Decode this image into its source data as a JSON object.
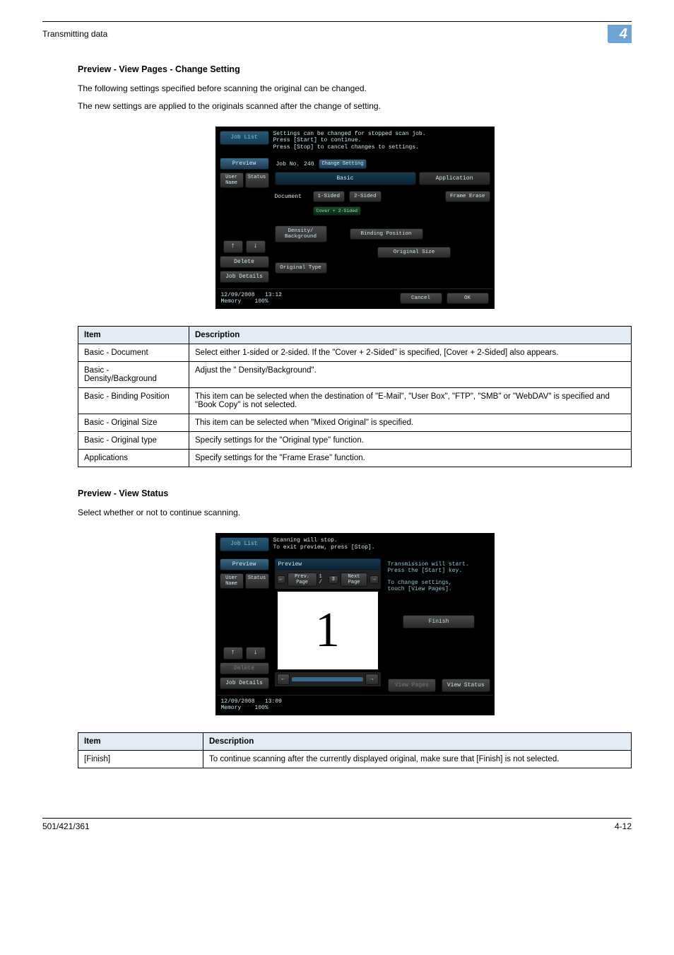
{
  "header": {
    "section": "Transmitting data",
    "chapter_number": "4"
  },
  "section1": {
    "heading": "Preview - View Pages - Change Setting",
    "p1": "The following settings specified before scanning the original can be changed.",
    "p2": "The new settings are applied to the originals scanned after the change of setting."
  },
  "screenshot1": {
    "job_list": "Job List",
    "msg_l1": "Settings can be changed for stopped scan job.",
    "msg_l2": "Press [Start] to continue.",
    "msg_l3": "Press [Stop] to cancel changes to settings.",
    "preview_btn": "Preview",
    "user_tab": "User Name",
    "status_tab": "Status",
    "up_arrow": "↑",
    "down_arrow": "↓",
    "delete_btn": "Delete",
    "job_details_btn": "Job Details",
    "job_no_label": "Job No.",
    "job_no_value": "240",
    "change_setting": "Change Setting",
    "tab_basic": "Basic",
    "tab_application": "Application",
    "lbl_document": "Document",
    "lbl_1sided": "1-Sided",
    "lbl_2sided": "2-Sided",
    "lbl_cover2sided": "Cover + 2-Sided",
    "lbl_frame_erase": "Frame Erase",
    "lbl_density": "Density/ Background",
    "lbl_binding": "Binding Position",
    "lbl_orig_size": "Original Size",
    "lbl_orig_type": "Original Type",
    "footer_date": "12/09/2008",
    "footer_time": "13:12",
    "footer_mem": "Memory",
    "footer_pct": "100%",
    "btn_cancel": "Cancel",
    "btn_ok": "OK"
  },
  "table1": {
    "h_item": "Item",
    "h_desc": "Description",
    "rows": [
      {
        "item": "Basic - Document",
        "desc": "Select either 1-sided or 2-sided. If the \"Cover + 2-Sided\" is specified, [Cover + 2-Sided] also appears."
      },
      {
        "item": "Basic - Density/Background",
        "desc": "Adjust the \" Density/Background\"."
      },
      {
        "item": "Basic - Binding Position",
        "desc": "This item can be selected when the destination of \"E-Mail\", \"User Box\", \"FTP\", \"SMB\" or \"WebDAV\" is specified and \"Book Copy\" is not selected."
      },
      {
        "item": "Basic - Original Size",
        "desc": "This item can be selected when \"Mixed Original\" is specified."
      },
      {
        "item": "Basic - Original type",
        "desc": "Specify settings for the \"Original type\" function."
      },
      {
        "item": "Applications",
        "desc": "Specify settings for the \"Frame Erase\" function."
      }
    ]
  },
  "section2": {
    "heading": "Preview - View Status",
    "p1": "Select whether or not to continue scanning."
  },
  "screenshot2": {
    "job_list": "Job List",
    "msg_l1": "Scanning will stop.",
    "msg_l2": "To exit preview, press [Stop].",
    "preview_btn": "Preview",
    "user_tab": "User Name",
    "status_tab": "Status",
    "up_arrow": "↑",
    "down_arrow": "↓",
    "delete_btn": "Delete",
    "job_details_btn": "Job Details",
    "preview_header": "Preview",
    "nav_left": "←",
    "prev_page": "Prev. Page",
    "page_count": "1 /",
    "page_total": "3",
    "next_page": "Next Page",
    "nav_right": "→",
    "big_number": "1",
    "side_l1": "Transmission will start.",
    "side_l2": "Press the [Start] key.",
    "side_l3": "To change settings,",
    "side_l4": "touch [View Pages].",
    "finish_btn": "Finish",
    "view_pages_btn": "View Pages",
    "view_status_btn": "View Status",
    "footer_date": "12/09/2008",
    "footer_time": "13:09",
    "footer_mem": "Memory",
    "footer_pct": "100%"
  },
  "table2": {
    "h_item": "Item",
    "h_desc": "Description",
    "rows": [
      {
        "item": "[Finish]",
        "desc": "To continue scanning after the currently displayed original, make sure that [Finish] is not selected."
      }
    ]
  },
  "footer": {
    "left": "501/421/361",
    "right": "4-12"
  }
}
